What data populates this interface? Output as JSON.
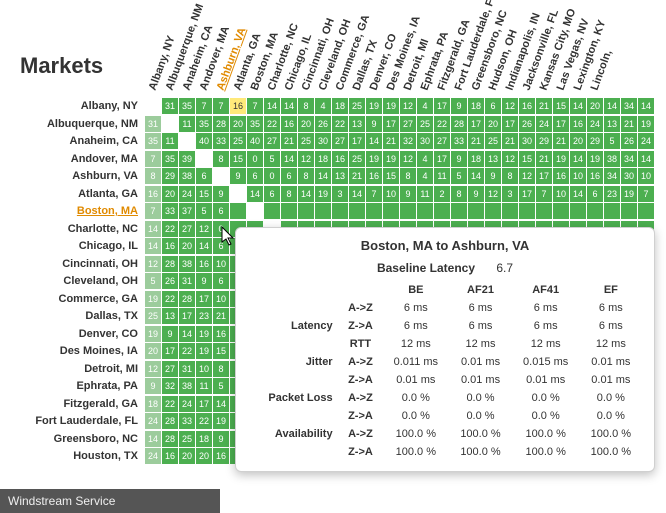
{
  "title": "Markets",
  "footer": "Windstream Service",
  "highlighted_column_index": 4,
  "highlighted_row_index": 6,
  "columns": [
    "Albany, NY",
    "Albuquerque, NM",
    "Anaheim, CA",
    "Andover, MA",
    "Ashburn, VA",
    "Atlanta, GA",
    "Boston, MA",
    "Charlotte, NC",
    "Chicago, IL",
    "Cincinnati, OH",
    "Cleveland, OH",
    "Commerce, GA",
    "Dallas, TX",
    "Denver, CO",
    "Des Moines, IA",
    "Detroit, MI",
    "Ephrata, PA",
    "Fitzgerald, GA",
    "Fort Lauderdale, FL",
    "Greensboro, NC",
    "Hudson, OH",
    "Indianapolis, IN",
    "Jacksonville, FL",
    "Kansas City, MO",
    "Las Vegas, NV",
    "Lexington, KY",
    "Lincoln, "
  ],
  "rows": [
    {
      "label": "Albany, NY",
      "cells": [
        "",
        "31",
        "35",
        "7",
        "7",
        "16",
        "7",
        "14",
        "14",
        "8",
        "4",
        "18",
        "25",
        "19",
        "19",
        "12",
        "4",
        "17",
        "9",
        "18",
        "6",
        "12",
        "16",
        "21",
        "15",
        "14",
        "20",
        "14",
        "34",
        "14"
      ]
    },
    {
      "label": "Albuquerque, NM",
      "cells": [
        "31",
        "",
        "11",
        "35",
        "28",
        "20",
        "35",
        "22",
        "16",
        "20",
        "26",
        "22",
        "13",
        "9",
        "17",
        "27",
        "25",
        "22",
        "28",
        "17",
        "20",
        "17",
        "26",
        "24",
        "17",
        "16",
        "24",
        "13",
        "21",
        "19"
      ]
    },
    {
      "label": "Anaheim, CA",
      "cells": [
        "35",
        "11",
        "",
        "40",
        "33",
        "25",
        "40",
        "27",
        "21",
        "25",
        "30",
        "27",
        "17",
        "14",
        "21",
        "32",
        "30",
        "27",
        "33",
        "21",
        "25",
        "21",
        "30",
        "29",
        "21",
        "20",
        "29",
        "5",
        "26",
        "24"
      ]
    },
    {
      "label": "Andover, MA",
      "cells": [
        "7",
        "35",
        "39",
        "",
        "8",
        "15",
        "0",
        "5",
        "14",
        "12",
        "18",
        "16",
        "25",
        "19",
        "19",
        "12",
        "4",
        "17",
        "9",
        "18",
        "13",
        "12",
        "15",
        "21",
        "19",
        "14",
        "19",
        "38",
        "34",
        "14"
      ]
    },
    {
      "label": "Ashburn, VA",
      "cells": [
        "8",
        "29",
        "38",
        "6",
        "",
        "9",
        "6",
        "0",
        "6",
        "8",
        "14",
        "13",
        "21",
        "16",
        "15",
        "8",
        "4",
        "11",
        "5",
        "14",
        "9",
        "8",
        "12",
        "17",
        "16",
        "10",
        "16",
        "34",
        "30",
        "10"
      ]
    },
    {
      "label": "Atlanta, GA",
      "cells": [
        "16",
        "20",
        "24",
        "15",
        "9",
        "",
        "14",
        "6",
        "8",
        "14",
        "19",
        "3",
        "14",
        "7",
        "10",
        "9",
        "11",
        "2",
        "8",
        "9",
        "12",
        "3",
        "17",
        "7",
        "10",
        "14",
        "6",
        "23",
        "19",
        "7"
      ]
    },
    {
      "label": "Boston, MA",
      "cells": [
        "7",
        "33",
        "37",
        "5",
        "6",
        "",
        "",
        "",
        "",
        "",
        "",
        "",
        "",
        "",
        "",
        "",
        "",
        "",
        "",
        "",
        "",
        "",
        "",
        "",
        "",
        "",
        "",
        "",
        "",
        ""
      ]
    },
    {
      "label": "Charlotte, NC",
      "cells": [
        "14",
        "22",
        "27",
        "12",
        "0",
        "",
        "",
        "",
        "",
        "",
        "",
        "",
        "",
        "",
        "",
        "",
        "",
        "",
        "",
        "",
        "",
        "",
        "",
        "",
        "",
        "",
        "",
        "",
        "",
        ""
      ]
    },
    {
      "label": "Chicago, IL",
      "cells": [
        "14",
        "16",
        "20",
        "14",
        "6",
        "",
        "",
        "",
        "",
        "",
        "",
        "",
        "",
        "",
        "",
        "",
        "",
        "",
        "",
        "",
        "",
        "",
        "",
        "",
        "",
        "",
        "",
        "",
        "",
        ""
      ]
    },
    {
      "label": "Cincinnati, OH",
      "cells": [
        "12",
        "28",
        "38",
        "16",
        "10",
        "",
        "",
        "",
        "",
        "",
        "",
        "",
        "",
        "",
        "",
        "",
        "",
        "",
        "",
        "",
        "",
        "",
        "",
        "",
        "",
        "",
        "",
        "",
        "",
        ""
      ]
    },
    {
      "label": "Cleveland, OH",
      "cells": [
        "5",
        "26",
        "31",
        "9",
        "6",
        "",
        "",
        "",
        "",
        "",
        "",
        "",
        "",
        "",
        "",
        "",
        "",
        "",
        "",
        "",
        "",
        "",
        "",
        "",
        "",
        "",
        "",
        "",
        "",
        ""
      ]
    },
    {
      "label": "Commerce, GA",
      "cells": [
        "19",
        "22",
        "28",
        "17",
        "10",
        "",
        "",
        "",
        "",
        "",
        "",
        "",
        "",
        "",
        "",
        "",
        "",
        "",
        "",
        "",
        "",
        "",
        "",
        "",
        "",
        "",
        "",
        "",
        "",
        ""
      ]
    },
    {
      "label": "Dallas, TX",
      "cells": [
        "25",
        "13",
        "17",
        "23",
        "21",
        "",
        "",
        "",
        "",
        "",
        "",
        "",
        "",
        "",
        "",
        "",
        "",
        "",
        "",
        "",
        "",
        "",
        "",
        "",
        "",
        "",
        "",
        "",
        "",
        ""
      ]
    },
    {
      "label": "Denver, CO",
      "cells": [
        "19",
        "9",
        "14",
        "19",
        "16",
        "",
        "",
        "",
        "",
        "",
        "",
        "",
        "",
        "",
        "",
        "",
        "",
        "",
        "",
        "",
        "",
        "",
        "",
        "",
        "",
        "",
        "",
        "",
        "",
        ""
      ]
    },
    {
      "label": "Des Moines, IA",
      "cells": [
        "20",
        "17",
        "22",
        "19",
        "15",
        "",
        "",
        "",
        "",
        "",
        "",
        "",
        "",
        "",
        "",
        "",
        "",
        "",
        "",
        "",
        "",
        "",
        "",
        "",
        "",
        "",
        "",
        "",
        "",
        ""
      ]
    },
    {
      "label": "Detroit, MI",
      "cells": [
        "12",
        "27",
        "31",
        "10",
        "8",
        "",
        "",
        "",
        "",
        "",
        "",
        "",
        "",
        "",
        "",
        "",
        "",
        "",
        "",
        "",
        "",
        "",
        "",
        "",
        "",
        "",
        "",
        "",
        "",
        ""
      ]
    },
    {
      "label": "Ephrata, PA",
      "cells": [
        "9",
        "32",
        "38",
        "11",
        "5",
        "",
        "",
        "",
        "",
        "",
        "",
        "",
        "",
        "",
        "",
        "",
        "",
        "",
        "",
        "",
        "",
        "",
        "",
        "",
        "",
        "",
        "",
        "",
        "",
        ""
      ]
    },
    {
      "label": "Fitzgerald, GA",
      "cells": [
        "18",
        "22",
        "24",
        "17",
        "14",
        "",
        "",
        "",
        "",
        "",
        "",
        "",
        "",
        "",
        "",
        "",
        "",
        "",
        "",
        "",
        "",
        "",
        "",
        "",
        "",
        "",
        "",
        "",
        "",
        ""
      ]
    },
    {
      "label": "Fort Lauderdale, FL",
      "cells": [
        "24",
        "28",
        "33",
        "22",
        "19",
        "",
        "",
        "",
        "",
        "",
        "",
        "",
        "",
        "",
        "",
        "",
        "",
        "",
        "",
        "",
        "",
        "",
        "",
        "",
        "",
        "",
        "",
        "",
        "",
        ""
      ]
    },
    {
      "label": "Greensboro, NC",
      "cells": [
        "14",
        "28",
        "25",
        "18",
        "9",
        "",
        "",
        "",
        "",
        "",
        "",
        "",
        "",
        "",
        "",
        "",
        "",
        "",
        "",
        "",
        "",
        "",
        "",
        "",
        "",
        "",
        "",
        "",
        "",
        ""
      ]
    },
    {
      "label": "Houston, TX",
      "cells": [
        "24",
        "16",
        "20",
        "20",
        "16",
        "",
        "",
        "",
        "",
        "",
        "",
        "",
        "",
        "",
        "",
        "",
        "",
        "",
        "",
        "",
        "",
        "",
        "",
        "",
        "",
        "",
        "",
        "",
        "",
        ""
      ]
    }
  ],
  "tooltip": {
    "title": "Boston, MA  to  Ashburn, VA",
    "baseline_label": "Baseline Latency",
    "baseline_value": "6.7",
    "col_headers": [
      "BE",
      "AF21",
      "AF41",
      "EF"
    ],
    "groups": [
      {
        "label": "Latency",
        "rows": [
          {
            "sub": "A->Z",
            "v": [
              "6 ms",
              "6 ms",
              "6 ms",
              "6 ms"
            ]
          },
          {
            "sub": "Z->A",
            "v": [
              "6 ms",
              "6 ms",
              "6 ms",
              "6 ms"
            ]
          },
          {
            "sub": "RTT",
            "v": [
              "12 ms",
              "12 ms",
              "12 ms",
              "12 ms"
            ]
          }
        ]
      },
      {
        "label": "Jitter",
        "rows": [
          {
            "sub": "A->Z",
            "v": [
              "0.011 ms",
              "0.01 ms",
              "0.015 ms",
              "0.01 ms"
            ]
          },
          {
            "sub": "Z->A",
            "v": [
              "0.01 ms",
              "0.01 ms",
              "0.01 ms",
              "0.01 ms"
            ]
          }
        ]
      },
      {
        "label": "Packet Loss",
        "rows": [
          {
            "sub": "A->Z",
            "v": [
              "0.0 %",
              "0.0 %",
              "0.0 %",
              "0.0 %"
            ]
          },
          {
            "sub": "Z->A",
            "v": [
              "0.0 %",
              "0.0 %",
              "0.0 %",
              "0.0 %"
            ]
          }
        ]
      },
      {
        "label": "Availability",
        "rows": [
          {
            "sub": "A->Z",
            "v": [
              "100.0 %",
              "100.0 %",
              "100.0 %",
              "100.0 %"
            ]
          },
          {
            "sub": "Z->A",
            "v": [
              "100.0 %",
              "100.0 %",
              "100.0 %",
              "100.0 %"
            ]
          }
        ]
      }
    ]
  }
}
